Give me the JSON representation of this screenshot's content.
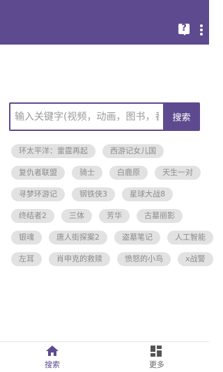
{
  "header": {
    "help_icon_glyph": "?",
    "colors": {
      "primary": "#5e4a8e"
    }
  },
  "search": {
    "placeholder": "输入关键字(视频，动画，图书，番号",
    "button_label": "搜索"
  },
  "tag_rows": [
    [
      "环太平洋：雷霆再起",
      "西游记女儿国"
    ],
    [
      "复仇者联盟",
      "骑士",
      "白鹿原",
      "天生一对"
    ],
    [
      "寻梦环游记",
      "钢铁侠3",
      "星球大战8"
    ],
    [
      "终结者2",
      "三体",
      "芳华",
      "古墓丽影"
    ],
    [
      "银魂",
      "唐人街探案2",
      "盗墓笔记",
      "人工智能"
    ],
    [
      "左耳",
      "肖申克的救赎",
      "愤怒的小鸟",
      "x战警"
    ]
  ],
  "bottom_nav": {
    "items": [
      {
        "label": "搜索",
        "icon": "home-icon",
        "active": true
      },
      {
        "label": "更多",
        "icon": "grid-icon",
        "active": false
      }
    ]
  }
}
